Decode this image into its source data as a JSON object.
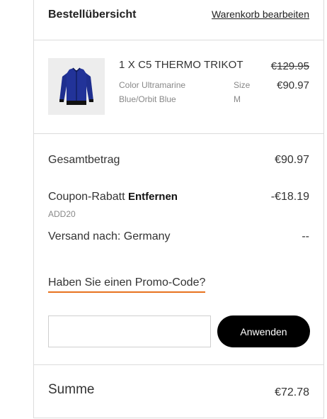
{
  "header": {
    "title": "Bestellübersicht",
    "edit_cart_link": "Warenkorb bearbeiten"
  },
  "item": {
    "name": "1 X C5 THERMO TRIKOT",
    "price_original": "€129.95",
    "price_current": "€90.97",
    "color_label": "Color",
    "color_value_line1": "Ultramarine",
    "color_value_line2": "Blue/Orbit Blue",
    "size_label": "Size",
    "size_value": "M",
    "image_icon": "jersey-image"
  },
  "summary": {
    "subtotal_label": "Gesamtbetrag",
    "subtotal_value": "€90.97",
    "coupon_label": "Coupon-Rabatt",
    "coupon_remove": "Entfernen",
    "coupon_code": "ADD20",
    "coupon_value": "-€18.19",
    "shipping_label": "Versand nach: Germany",
    "shipping_value": "--",
    "promo_link": "Haben Sie einen Promo-Code?",
    "promo_input_value": "",
    "promo_input_placeholder": "",
    "apply_button": "Anwenden"
  },
  "total": {
    "label": "Summe",
    "value": "€72.78"
  },
  "colors": {
    "accent_underline": "#e8731f",
    "button_bg": "#000000",
    "jersey": "#1f2f8f"
  }
}
